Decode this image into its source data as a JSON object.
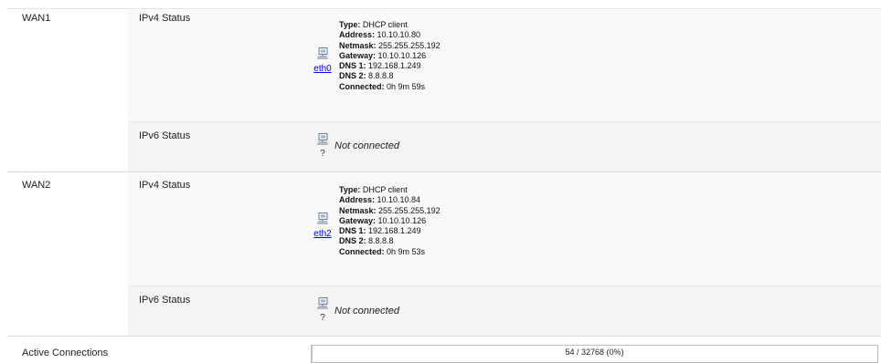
{
  "interfaces": [
    {
      "name": "WAN1",
      "ipv4_label": "IPv4 Status",
      "ipv4": {
        "device": "eth0",
        "device_icon": "network-port-icon",
        "lines": [
          {
            "label": "Type:",
            "value": " DHCP client"
          },
          {
            "label": "Address:",
            "value": " 10.10.10.80"
          },
          {
            "label": "Netmask:",
            "value": " 255.255.255.192"
          },
          {
            "label": "Gateway:",
            "value": " 10.10.10.126"
          },
          {
            "label": "DNS 1:",
            "value": " 192.168.1.249"
          },
          {
            "label": "DNS 2:",
            "value": " 8.8.8.8"
          },
          {
            "label": "Connected:",
            "value": " 0h 9m 59s"
          }
        ]
      },
      "ipv6_label": "IPv6 Status",
      "ipv6": {
        "device": "?",
        "device_icon": "network-port-icon",
        "status": "Not connected"
      }
    },
    {
      "name": "WAN2",
      "ipv4_label": "IPv4 Status",
      "ipv4": {
        "device": "eth2",
        "device_icon": "network-port-icon",
        "lines": [
          {
            "label": "Type:",
            "value": " DHCP client"
          },
          {
            "label": "Address:",
            "value": " 10.10.10.84"
          },
          {
            "label": "Netmask:",
            "value": " 255.255.255.192"
          },
          {
            "label": "Gateway:",
            "value": " 10.10.10.126"
          },
          {
            "label": "DNS 1:",
            "value": " 192.168.1.249"
          },
          {
            "label": "DNS 2:",
            "value": " 8.8.8.8"
          },
          {
            "label": "Connected:",
            "value": " 0h 9m 53s"
          }
        ]
      },
      "ipv6_label": "IPv6 Status",
      "ipv6": {
        "device": "?",
        "device_icon": "network-port-icon",
        "status": "Not connected"
      }
    }
  ],
  "active_connections": {
    "label": "Active Connections",
    "text": "54 / 32768 (0%)",
    "fraction": 0.0016,
    "fill_color": "#b9d7a4"
  }
}
